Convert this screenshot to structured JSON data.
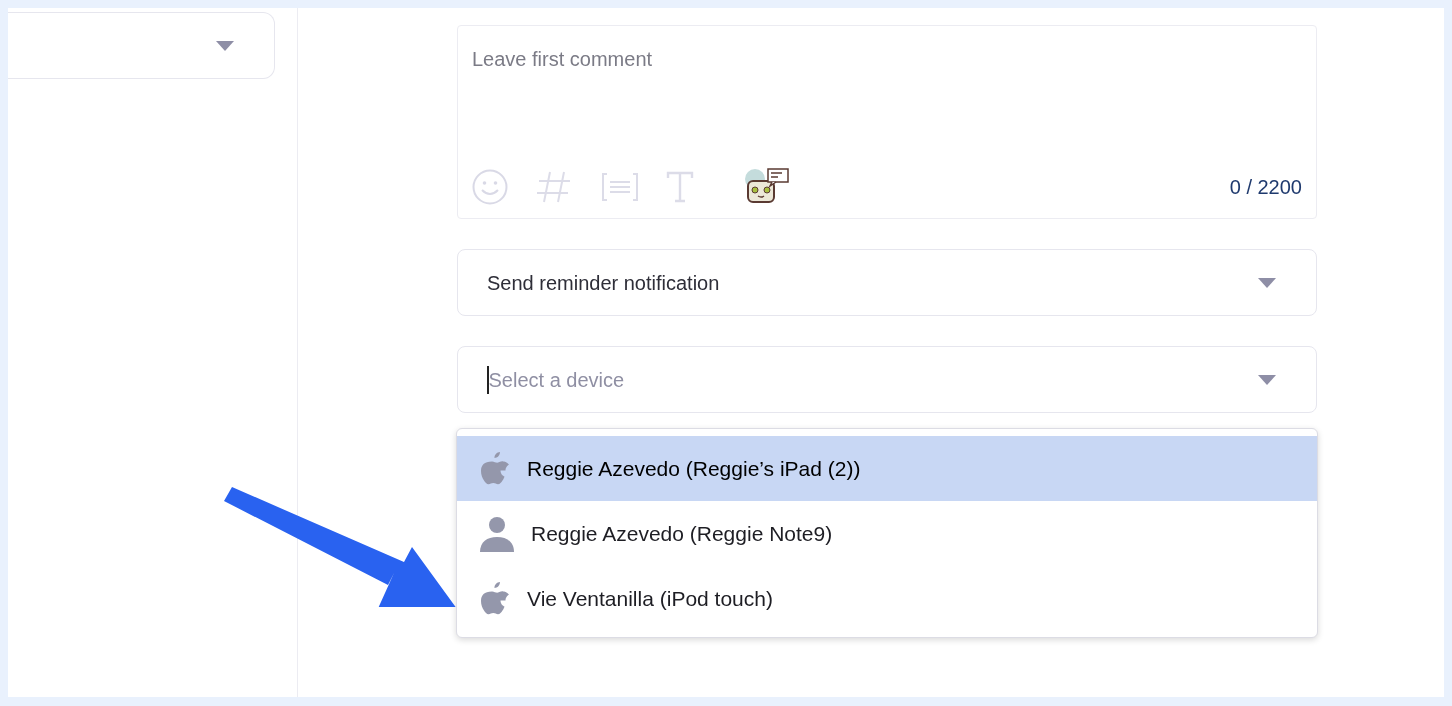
{
  "left_select": {
    "expanded": false
  },
  "comment": {
    "placeholder": "Leave first comment",
    "counter": "0 / 2200"
  },
  "reminder": {
    "value": "Send reminder notification"
  },
  "device": {
    "placeholder": "Select a device",
    "options": [
      {
        "kind": "apple",
        "label": "Reggie Azevedo (Reggie’s iPad (2))",
        "selected": true
      },
      {
        "kind": "person",
        "label": "Reggie Azevedo (Reggie Note9)",
        "selected": false
      },
      {
        "kind": "apple",
        "label": "Vie Ventanilla (iPod touch)",
        "selected": false
      }
    ]
  }
}
